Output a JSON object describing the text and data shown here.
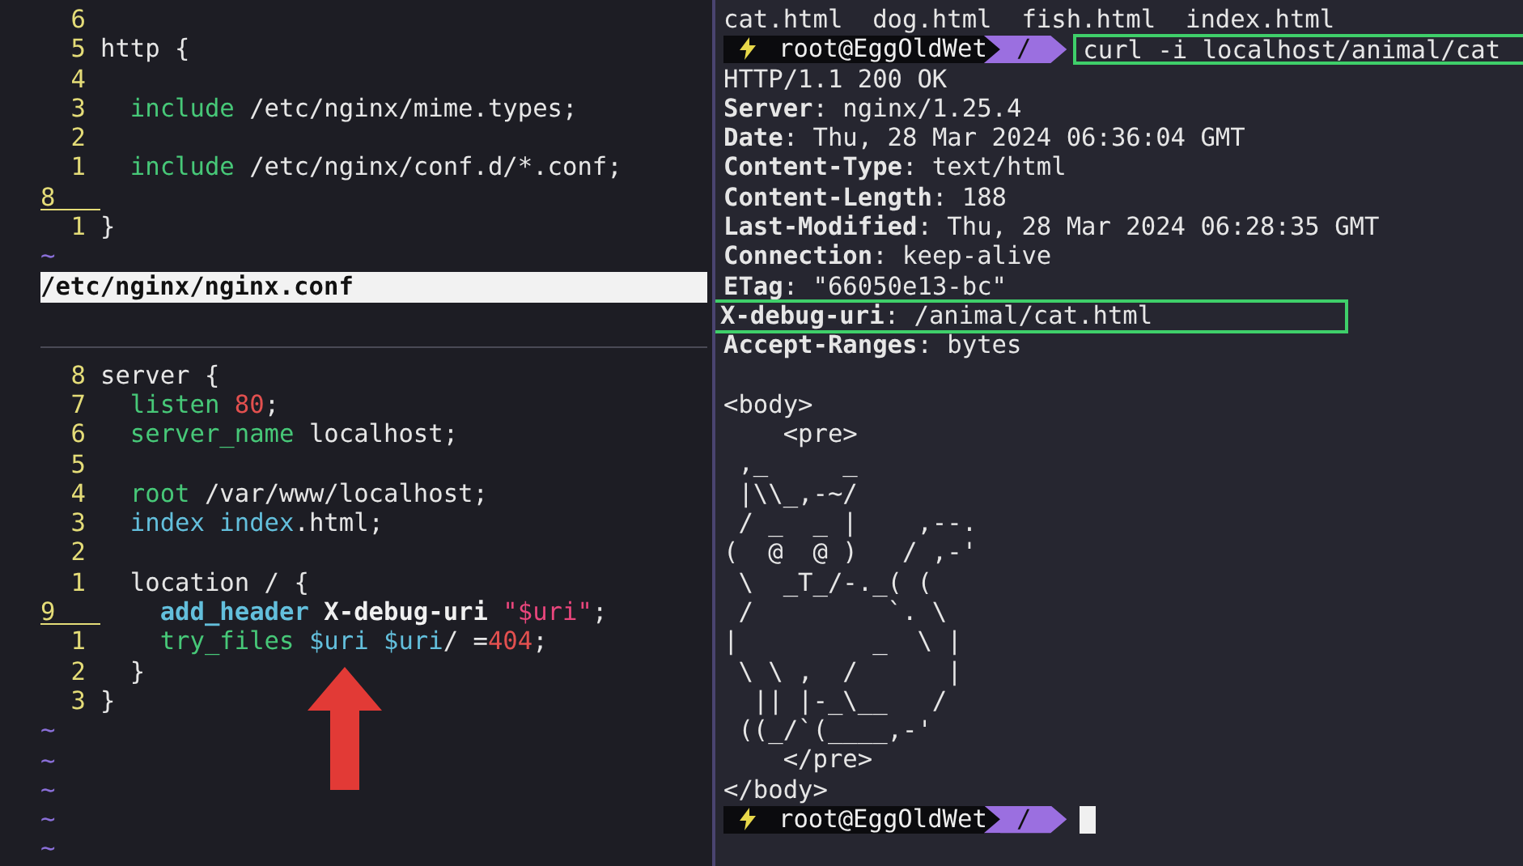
{
  "editor": {
    "top_window": {
      "lines": [
        {
          "kind": "code",
          "number": "6",
          "current": false
        },
        {
          "kind": "code",
          "number": "5",
          "current": false,
          "tokens": [
            {
              "text": "http {",
              "kind": "plain"
            }
          ]
        },
        {
          "kind": "code",
          "number": "4",
          "current": false
        },
        {
          "kind": "code",
          "number": "3",
          "current": false,
          "tokens": [
            {
              "text": "  include",
              "kind": "keyword"
            },
            {
              "text": " /etc/nginx/mime.types;",
              "kind": "plain"
            }
          ]
        },
        {
          "kind": "code",
          "number": "2",
          "current": false
        },
        {
          "kind": "code",
          "number": "1",
          "current": false,
          "tokens": [
            {
              "text": "  include",
              "kind": "keyword"
            },
            {
              "text": " /etc/nginx/conf.d/*.conf;",
              "kind": "plain"
            }
          ]
        },
        {
          "kind": "code",
          "number": "8",
          "current": true
        },
        {
          "kind": "code",
          "number": "1",
          "current": false,
          "tokens": [
            {
              "text": "}",
              "kind": "plain"
            }
          ]
        },
        {
          "kind": "filler",
          "text": "~"
        }
      ]
    },
    "status_line": "/etc/nginx/nginx.conf",
    "bottom_window": {
      "lines": [
        {
          "kind": "code",
          "number": "8",
          "current": false,
          "tokens": [
            {
              "text": "server {",
              "kind": "plain"
            }
          ]
        },
        {
          "kind": "code",
          "number": "7",
          "current": false,
          "tokens": [
            {
              "text": "  listen ",
              "kind": "keyword"
            },
            {
              "text": "80",
              "kind": "number"
            },
            {
              "text": ";",
              "kind": "plain"
            }
          ]
        },
        {
          "kind": "code",
          "number": "6",
          "current": false,
          "tokens": [
            {
              "text": "  server_name",
              "kind": "keyword"
            },
            {
              "text": " localhost;",
              "kind": "plain"
            }
          ]
        },
        {
          "kind": "code",
          "number": "5",
          "current": false
        },
        {
          "kind": "code",
          "number": "4",
          "current": false,
          "tokens": [
            {
              "text": "  root",
              "kind": "keyword"
            },
            {
              "text": " /var/www/localhost;",
              "kind": "plain"
            }
          ]
        },
        {
          "kind": "code",
          "number": "3",
          "current": false,
          "tokens": [
            {
              "text": "  index index",
              "kind": "builtin"
            },
            {
              "text": ".html;",
              "kind": "plain"
            }
          ]
        },
        {
          "kind": "code",
          "number": "2",
          "current": false
        },
        {
          "kind": "code",
          "number": "1",
          "current": false,
          "tokens": [
            {
              "text": "  location / {",
              "kind": "plain"
            }
          ]
        },
        {
          "kind": "code",
          "number": "9",
          "current": true,
          "tokens": [
            {
              "text": "    add_header ",
              "kind": "directive"
            },
            {
              "text": "X-debug-uri ",
              "kind": "name"
            },
            {
              "text": "\"$uri\"",
              "kind": "string"
            },
            {
              "text": ";",
              "kind": "plain"
            }
          ]
        },
        {
          "kind": "code",
          "number": "1",
          "current": false,
          "tokens": [
            {
              "text": "    try_files ",
              "kind": "keyword"
            },
            {
              "text": "$uri $uri",
              "kind": "builtin"
            },
            {
              "text": "/ =",
              "kind": "plain"
            },
            {
              "text": "404",
              "kind": "number"
            },
            {
              "text": ";",
              "kind": "plain"
            }
          ]
        },
        {
          "kind": "code",
          "number": "2",
          "current": false,
          "tokens": [
            {
              "text": "  }",
              "kind": "plain"
            }
          ]
        },
        {
          "kind": "code",
          "number": "3",
          "current": false,
          "tokens": [
            {
              "text": "}",
              "kind": "plain"
            }
          ]
        },
        {
          "kind": "filler",
          "text": "~"
        },
        {
          "kind": "filler",
          "text": "~"
        },
        {
          "kind": "filler",
          "text": "~"
        },
        {
          "kind": "filler",
          "text": "~"
        },
        {
          "kind": "filler",
          "text": "~"
        }
      ]
    }
  },
  "terminal": {
    "listing": "cat.html  dog.html  fish.html  index.html",
    "prompt": {
      "user": "root@EggOldWet",
      "path": "/",
      "command": "curl -i localhost/animal/cat",
      "highlighted": true
    },
    "status_line": "HTTP/1.1 200 OK",
    "headers": [
      {
        "name": "Server",
        "value": ": nginx/1.25.4",
        "highlighted": false
      },
      {
        "name": "Date",
        "value": ": Thu, 28 Mar 2024 06:36:04 GMT",
        "highlighted": false
      },
      {
        "name": "Content-Type",
        "value": ": text/html",
        "highlighted": false
      },
      {
        "name": "Content-Length",
        "value": ": 188",
        "highlighted": false
      },
      {
        "name": "Last-Modified",
        "value": ": Thu, 28 Mar 2024 06:28:35 GMT",
        "highlighted": false
      },
      {
        "name": "Connection",
        "value": ": keep-alive",
        "highlighted": false
      },
      {
        "name": "ETag",
        "value": ": \"66050e13-bc\"",
        "highlighted": false
      },
      {
        "name": "X-debug-uri",
        "value": ": /animal/cat.html",
        "highlighted": true
      },
      {
        "name": "Accept-Ranges",
        "value": ": bytes",
        "highlighted": false
      }
    ],
    "body_lines": [
      "<body>",
      "    <pre>",
      " ,_     _",
      " |\\\\_,-~/",
      " / _  _ |    ,--.",
      "(  @  @ )   / ,-'",
      " \\  _T_/-._( (",
      " /         `. \\",
      "|         _  \\ |",
      " \\ \\ ,  /      |",
      "  || |-_\\__   /",
      " ((_/`(____,-'",
      "    </pre>",
      "</body>"
    ],
    "final_prompt": {
      "user": "root@EggOldWet",
      "path": "/",
      "cursor": true
    }
  }
}
